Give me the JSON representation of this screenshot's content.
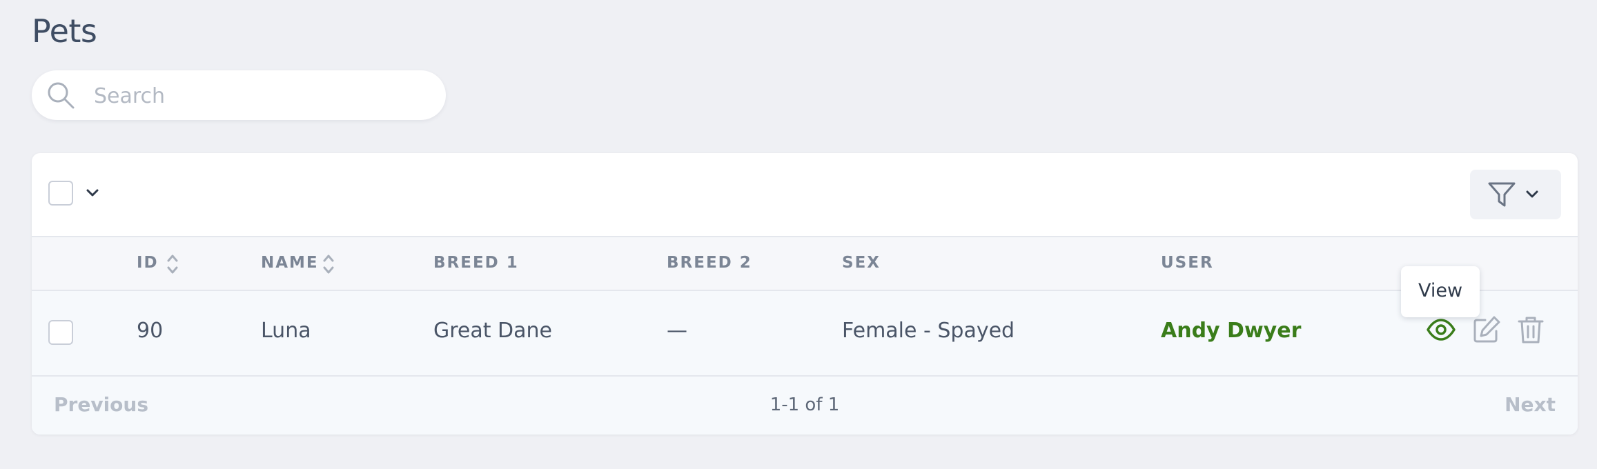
{
  "page": {
    "title": "Pets"
  },
  "search": {
    "placeholder": "Search",
    "value": ""
  },
  "table": {
    "columns": [
      {
        "key": "id",
        "label": "ID",
        "sortable": true
      },
      {
        "key": "name",
        "label": "NAME",
        "sortable": true
      },
      {
        "key": "breed1",
        "label": "BREED 1",
        "sortable": false
      },
      {
        "key": "breed2",
        "label": "BREED 2",
        "sortable": false
      },
      {
        "key": "sex",
        "label": "SEX",
        "sortable": false
      },
      {
        "key": "user",
        "label": "USER",
        "sortable": false
      }
    ],
    "rows": [
      {
        "id": "90",
        "name": "Luna",
        "breed1": "Great Dane",
        "breed2": "—",
        "sex": "Female - Spayed",
        "user": "Andy Dwyer"
      }
    ],
    "row_actions": [
      "eye-icon",
      "edit-icon",
      "trash-icon"
    ],
    "tooltip": "View"
  },
  "pagination": {
    "previous": "Previous",
    "summary": "1-1 of 1",
    "next": "Next"
  },
  "colors": {
    "accent": "#3a7d1a",
    "background": "#eff0f4"
  }
}
